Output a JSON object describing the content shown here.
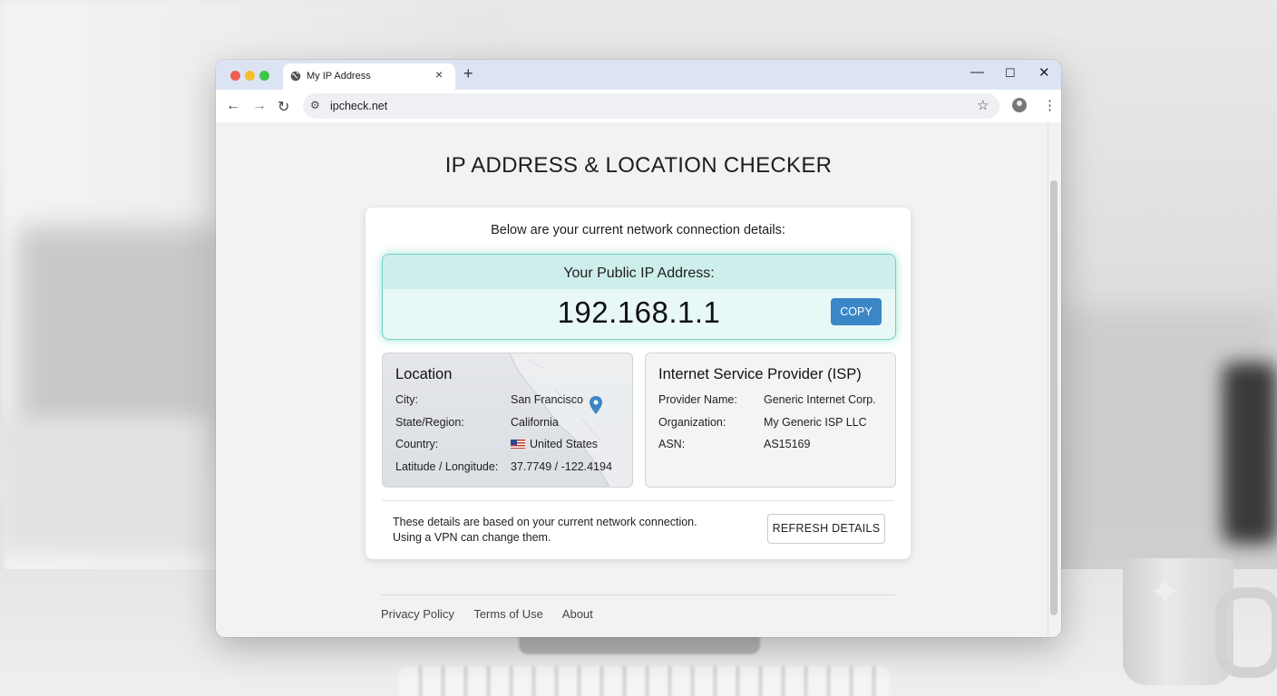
{
  "browser": {
    "tab_title": "My IP Address",
    "url": "ipcheck.net"
  },
  "page": {
    "title": "IP ADDRESS & LOCATION CHECKER",
    "intro": "Below are your current network connection details:",
    "ip": {
      "label": "Your Public IP Address:",
      "value": "192.168.1.1",
      "copy_label": "COPY"
    },
    "location": {
      "heading": "Location",
      "rows": [
        {
          "key": "City:",
          "value": "San Francisco"
        },
        {
          "key": "State/Region:",
          "value": "California"
        },
        {
          "key": "Country:",
          "value": "United States"
        },
        {
          "key": "Latitude / Longitude:",
          "value": "37.7749 / -122.4194"
        }
      ]
    },
    "isp": {
      "heading": "Internet Service Provider (ISP)",
      "rows": [
        {
          "key": "Provider Name:",
          "value": "Generic Internet Corp."
        },
        {
          "key": "Organization:",
          "value": "My Generic ISP LLC"
        },
        {
          "key": "ASN:",
          "value": "AS15169"
        }
      ]
    },
    "note_line1": "These details are based on your current network connection.",
    "note_line2": "Using a VPN can change them.",
    "refresh_label": "REFRESH DETAILS",
    "footer_links": [
      "Privacy Policy",
      "Terms of Use",
      "About"
    ]
  },
  "colors": {
    "accent": "#3b86c6",
    "ip_border": "#71cfc2",
    "map_pin": "#3b86c6"
  }
}
